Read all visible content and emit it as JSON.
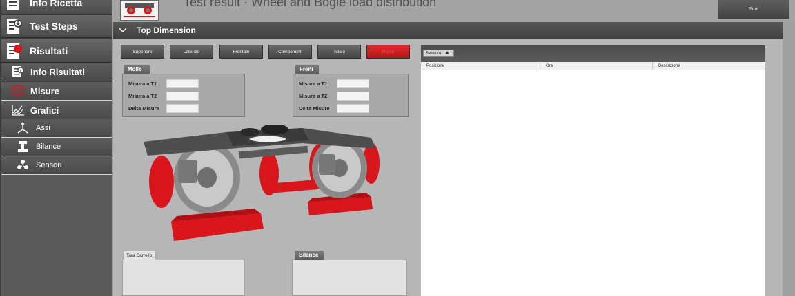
{
  "sidebar": {
    "items": [
      {
        "label": "Info Ricetta",
        "icon": "document-icon"
      },
      {
        "label": "Test Steps",
        "icon": "document-download-icon"
      },
      {
        "label": "Risultati",
        "icon": "document-results-icon"
      },
      {
        "label": "Info Risultati",
        "icon": "document-info-icon"
      },
      {
        "label": "Misure",
        "icon": "measure-icon"
      },
      {
        "label": "Grafici",
        "icon": "chart-icon"
      },
      {
        "label": "Assi",
        "icon": "axes-icon"
      },
      {
        "label": "Bilance",
        "icon": "rail-scale-icon"
      },
      {
        "label": "Sensori",
        "icon": "sensors-icon"
      }
    ]
  },
  "header": {
    "title": "Test result - Wheel and Bogie load distribution",
    "print_label": "Print"
  },
  "section": {
    "title": "Top Dimension"
  },
  "view_tabs": [
    {
      "label": "Superiore",
      "active": false
    },
    {
      "label": "Laterale",
      "active": false
    },
    {
      "label": "Frontale",
      "active": false
    },
    {
      "label": "Componenti",
      "active": false
    },
    {
      "label": "Telaio",
      "active": false
    },
    {
      "label": "Ruote",
      "active": true
    }
  ],
  "molle": {
    "title": "Molle",
    "fields": [
      {
        "label": "Misura a T1",
        "value": ""
      },
      {
        "label": "Misura a T2",
        "value": ""
      },
      {
        "label": "Delta Misure",
        "value": ""
      }
    ]
  },
  "freni": {
    "title": "Freni",
    "fields": [
      {
        "label": "Misura a T1",
        "value": ""
      },
      {
        "label": "Misura a T2",
        "value": ""
      },
      {
        "label": "Delta Misure",
        "value": ""
      }
    ]
  },
  "tara": {
    "title": "Tara Carrello"
  },
  "bilance": {
    "title": "Bilance"
  },
  "grid": {
    "group_by": "Sensore",
    "columns": [
      "Posizione",
      "Ora",
      "Descrizione"
    ]
  },
  "colors": {
    "accent_red": "#d8161c",
    "bar_dark": "#4a4a4a"
  }
}
